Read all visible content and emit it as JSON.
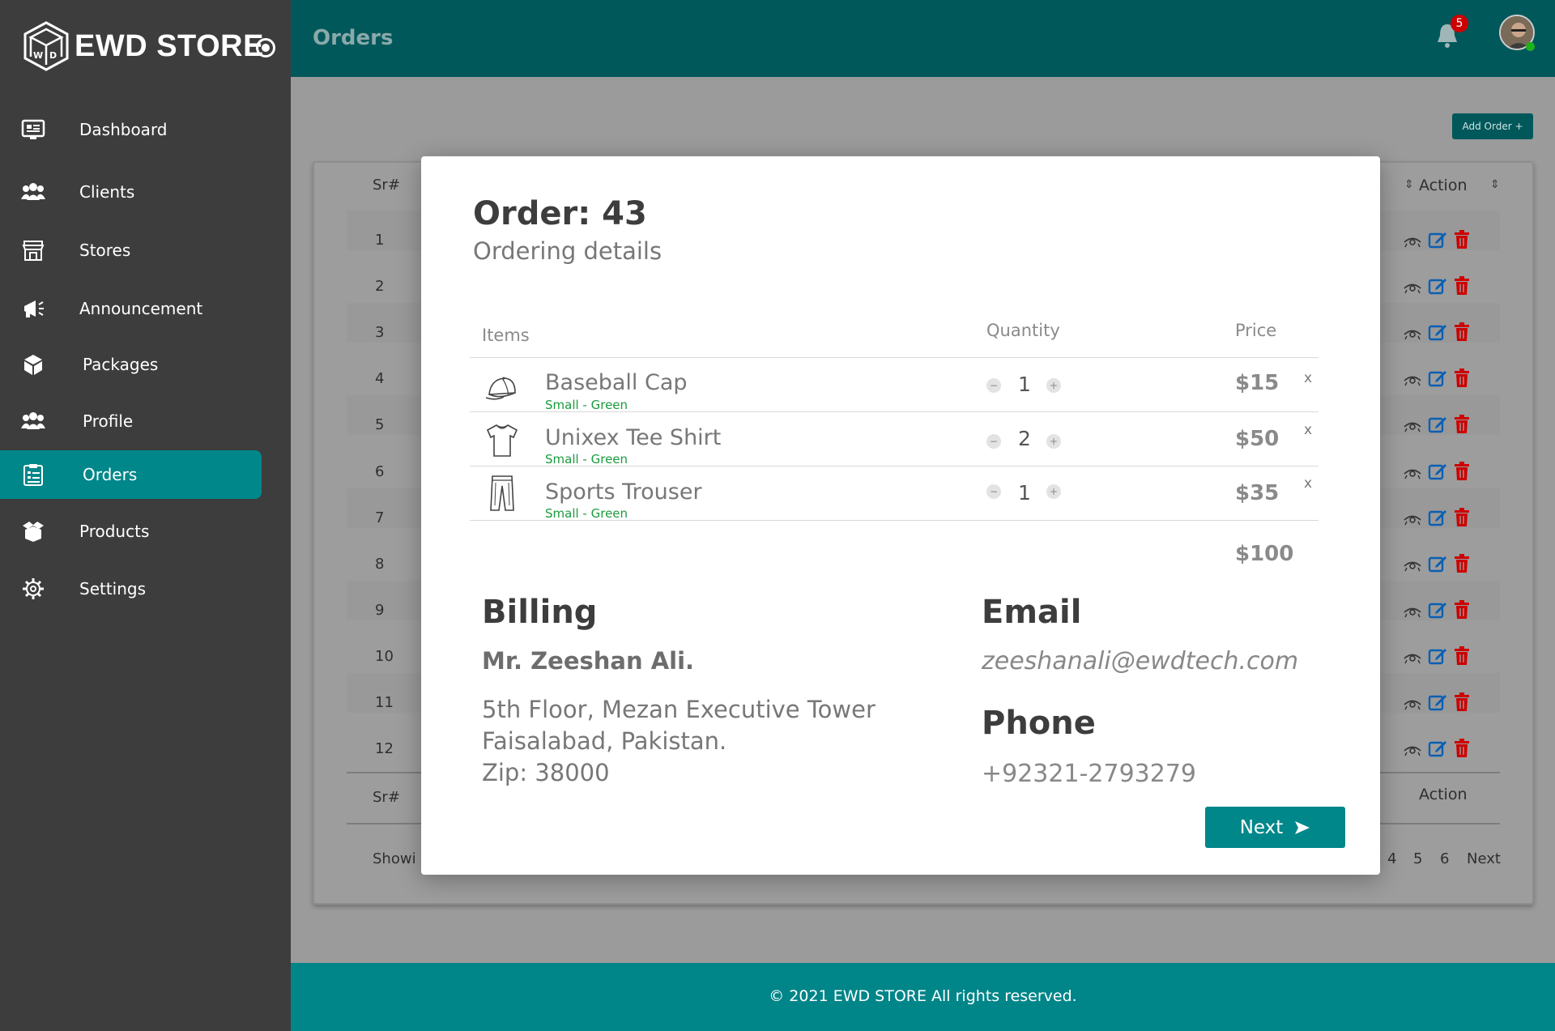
{
  "brand": {
    "name": "EWD STORE"
  },
  "sidebar": {
    "items": [
      {
        "label": "Dashboard",
        "icon": "dashboard-icon",
        "active": false
      },
      {
        "label": "Clients",
        "icon": "users-icon",
        "active": false
      },
      {
        "label": "Stores",
        "icon": "store-icon",
        "active": false
      },
      {
        "label": "Announcement",
        "icon": "megaphone-icon",
        "active": false
      },
      {
        "label": "Packages",
        "icon": "packages-icon",
        "active": false
      },
      {
        "label": "Profile",
        "icon": "users-icon",
        "active": false
      },
      {
        "label": "Orders",
        "icon": "clipboard-icon",
        "active": true
      },
      {
        "label": "Products",
        "icon": "box-icon",
        "active": false
      },
      {
        "label": "Settings",
        "icon": "gear-icon",
        "active": false
      }
    ]
  },
  "header": {
    "title": "Orders",
    "notification_count": "5"
  },
  "orders_page": {
    "add_order_label": "Add Order +",
    "columns": {
      "sr": "Sr#",
      "action": "Action"
    },
    "rows": [
      "1",
      "2",
      "3",
      "4",
      "5",
      "6",
      "7",
      "8",
      "9",
      "10",
      "11",
      "12"
    ],
    "showing_text": "Showi",
    "pagination": {
      "pages": [
        "4",
        "5",
        "6"
      ],
      "next_label": "Next"
    }
  },
  "modal": {
    "title": "Order: 43",
    "subtitle": "Ordering details",
    "columns": {
      "items": "Items",
      "quantity": "Quantity",
      "price": "Price"
    },
    "items": [
      {
        "name": "Baseball Cap",
        "variant": "Small - Green",
        "quantity": "1",
        "price": "$15",
        "icon": "cap-icon"
      },
      {
        "name": "Unixex Tee Shirt",
        "variant": "Small - Green",
        "quantity": "2",
        "price": "$50",
        "icon": "tshirt-icon"
      },
      {
        "name": "Sports Trouser",
        "variant": "Small - Green",
        "quantity": "1",
        "price": "$35",
        "icon": "trouser-icon"
      }
    ],
    "total": "$100",
    "billing": {
      "heading": "Billing",
      "name": "Mr. Zeeshan Ali.",
      "address_lines": [
        "5th Floor, Mezan Executive Tower",
        "Faisalabad, Pakistan.",
        "Zip: 38000"
      ]
    },
    "email": {
      "heading": "Email",
      "value": "zeeshanali@ewdtech.com"
    },
    "phone": {
      "heading": "Phone",
      "value": "+92321-2793279"
    },
    "next_label": "Next"
  },
  "footer": {
    "text": "© 2021 EWD STORE  All rights reserved."
  },
  "colors": {
    "teal": "#00878a",
    "teal_dark": "#00585b",
    "sidebar": "#3d3d3d",
    "danger": "#cc0000",
    "edit": "#0a5fb3",
    "variant_green": "#1a9b3e"
  }
}
